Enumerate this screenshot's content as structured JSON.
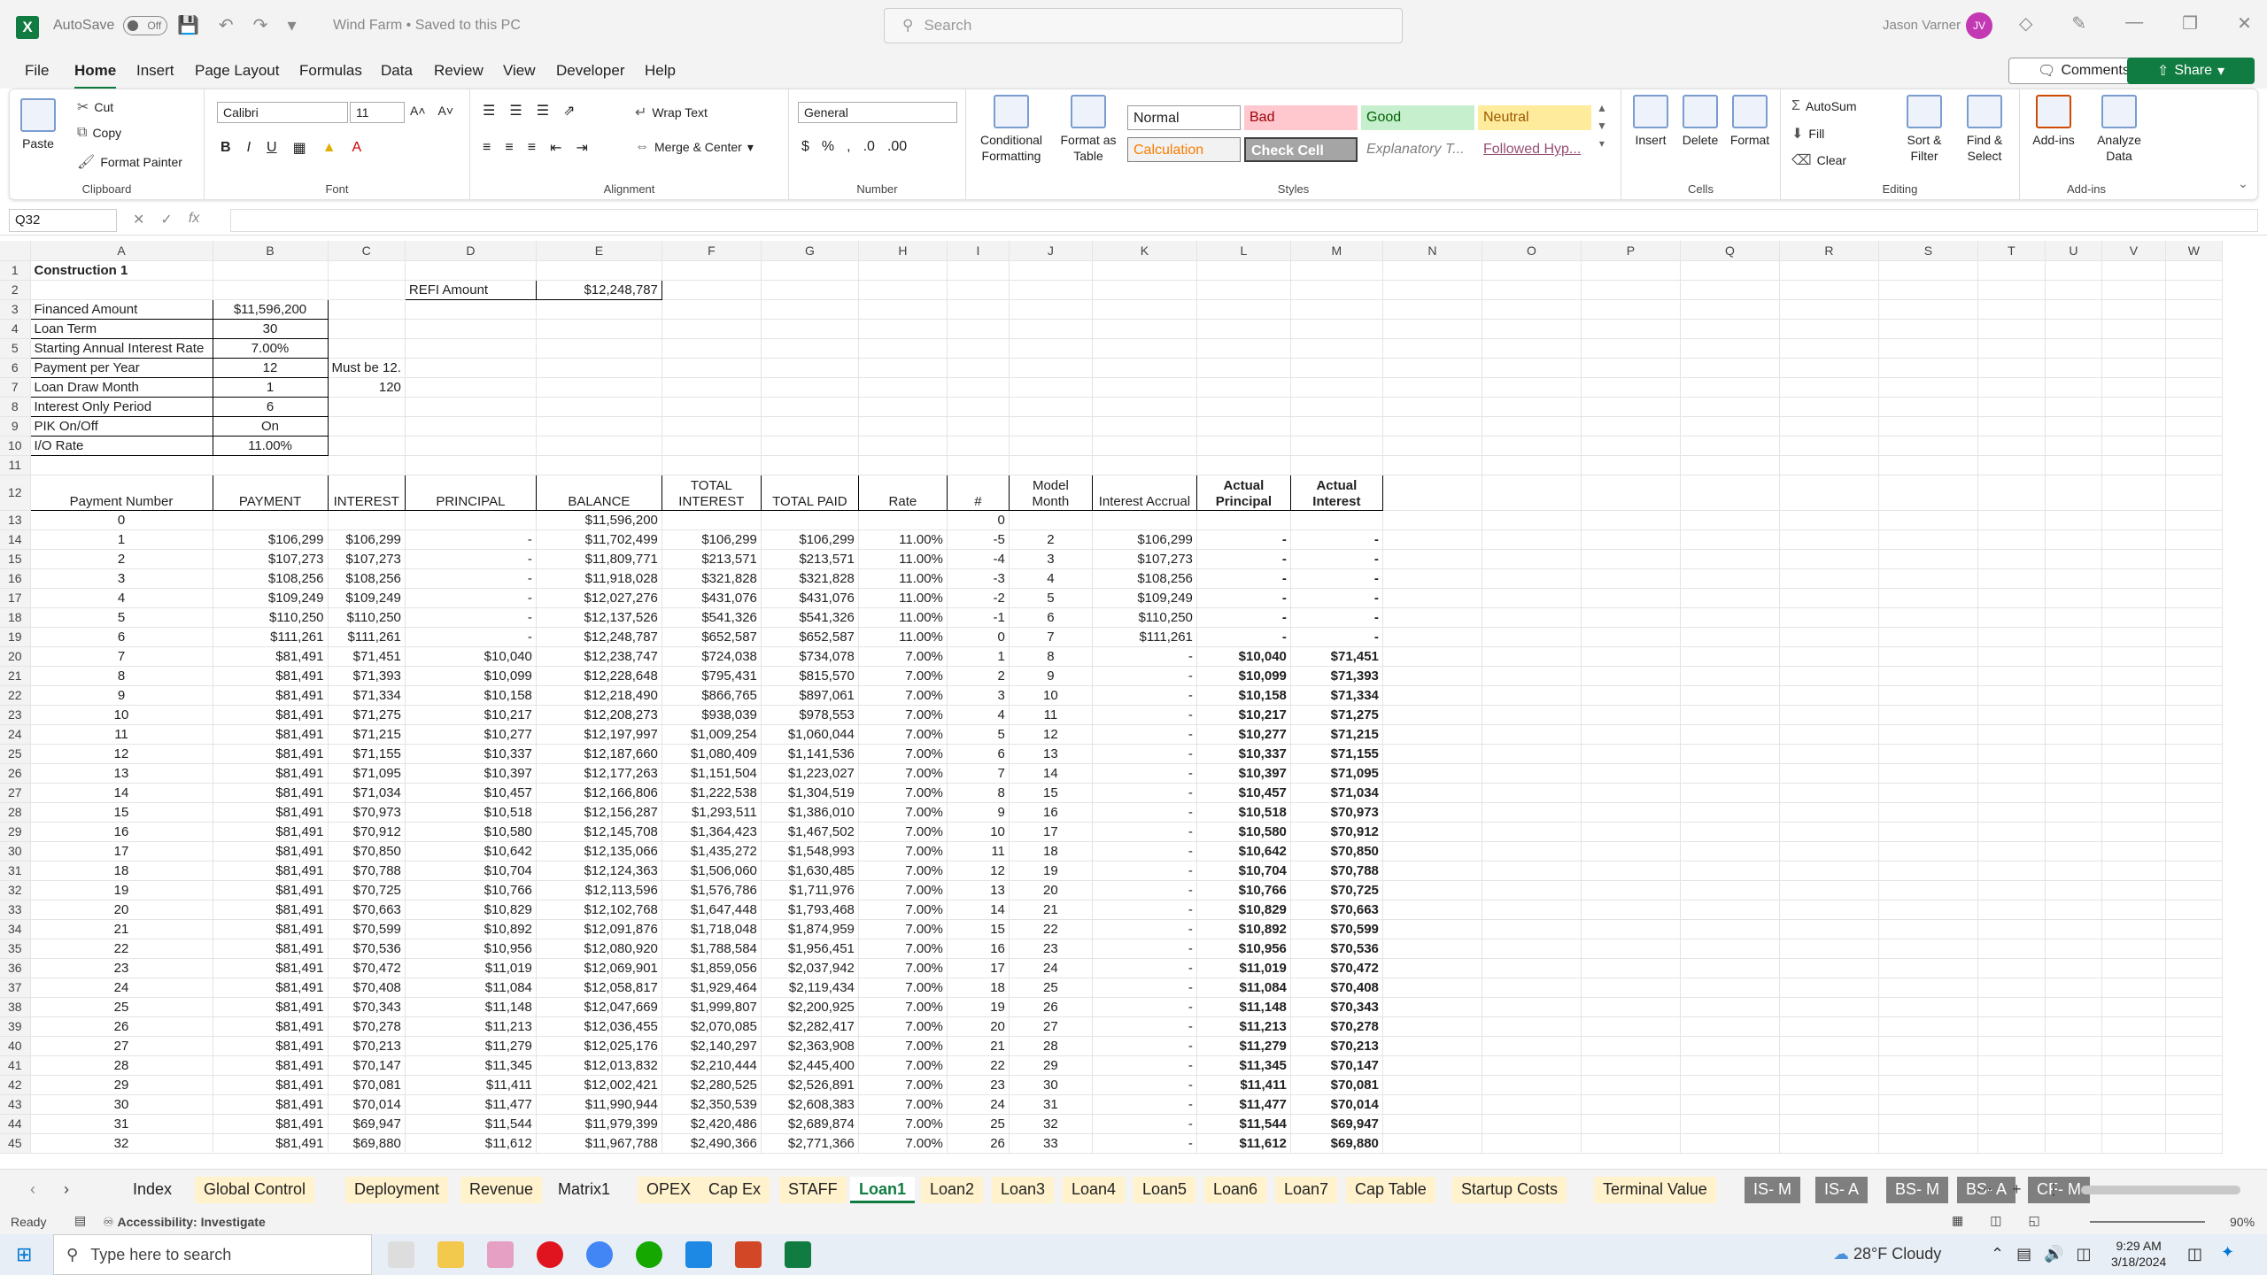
{
  "titlebar": {
    "app_logo": "X",
    "autosave_label": "AutoSave",
    "autosave_state": "Off",
    "doc_title": "Wind Farm • Saved to this PC",
    "search_placeholder": "Search",
    "user_name": "Jason Varner",
    "user_initials": "JV"
  },
  "menu": {
    "items": [
      "File",
      "Home",
      "Insert",
      "Page Layout",
      "Formulas",
      "Data",
      "Review",
      "View",
      "Developer",
      "Help"
    ],
    "active": "Home",
    "comments": "Comments",
    "share": "Share"
  },
  "ribbon": {
    "clipboard": {
      "paste": "Paste",
      "cut": "Cut",
      "copy": "Copy",
      "format_painter": "Format Painter",
      "label": "Clipboard"
    },
    "font": {
      "name": "Calibri",
      "size": "11",
      "label": "Font"
    },
    "alignment": {
      "wrap": "Wrap Text",
      "merge": "Merge & Center",
      "label": "Alignment"
    },
    "number": {
      "format": "General",
      "label": "Number"
    },
    "styles": {
      "conditional": "Conditional Formatting",
      "format_table": "Format as Table",
      "normal": "Normal",
      "bad": "Bad",
      "good": "Good",
      "neutral": "Neutral",
      "calculation": "Calculation",
      "check_cell": "Check Cell",
      "explanatory": "Explanatory T...",
      "followed": "Followed Hyp...",
      "label": "Styles"
    },
    "cells": {
      "insert": "Insert",
      "delete": "Delete",
      "format": "Format",
      "label": "Cells"
    },
    "editing": {
      "autosum": "AutoSum",
      "fill": "Fill",
      "clear": "Clear",
      "sort": "Sort & Filter",
      "find": "Find & Select",
      "label": "Editing"
    },
    "addins": {
      "addins": "Add-ins",
      "analyze": "Analyze Data",
      "label": "Add-ins"
    }
  },
  "formula_bar": {
    "name_box": "Q32",
    "fx": "fx",
    "content": ""
  },
  "columns": [
    "A",
    "B",
    "C",
    "D",
    "E",
    "F",
    "G",
    "H",
    "I",
    "J",
    "K",
    "L",
    "M",
    "N",
    "O",
    "P",
    "Q",
    "R",
    "S",
    "T",
    "U",
    "V",
    "W"
  ],
  "params": {
    "title": "Construction 1",
    "refi_label": "REFI Amount",
    "refi_value": "$12,248,787",
    "rows": [
      {
        "label": "Financed Amount",
        "value": "$11,596,200",
        "note": ""
      },
      {
        "label": "Loan Term",
        "value": "30",
        "note": ""
      },
      {
        "label": "Starting Annual Interest Rate",
        "value": "7.00%",
        "note": ""
      },
      {
        "label": "Payment per Year",
        "value": "12",
        "note": "Must be 12."
      },
      {
        "label": "Loan Draw Month",
        "value": "1",
        "note": "120"
      },
      {
        "label": "Interest Only Period",
        "value": "6",
        "note": ""
      },
      {
        "label": "PIK On/Off",
        "value": "On",
        "note": ""
      },
      {
        "label": "I/O Rate",
        "value": "11.00%",
        "note": ""
      }
    ]
  },
  "schedule": {
    "headers": [
      "Payment Number",
      "PAYMENT",
      "INTEREST",
      "PRINCIPAL",
      "BALANCE",
      "TOTAL INTEREST",
      "TOTAL PAID",
      "Rate",
      "#",
      "Model Month",
      "Interest Accrual",
      "Actual Principal",
      "Actual Interest"
    ],
    "rows": [
      [
        "0",
        "",
        "",
        "",
        "$11,596,200",
        "",
        "",
        "",
        "0",
        "",
        "",
        "",
        ""
      ],
      [
        "1",
        "$106,299",
        "$106,299",
        "-",
        "$11,702,499",
        "$106,299",
        "$106,299",
        "11.00%",
        "-5",
        "2",
        "$106,299",
        "-",
        "-"
      ],
      [
        "2",
        "$107,273",
        "$107,273",
        "-",
        "$11,809,771",
        "$213,571",
        "$213,571",
        "11.00%",
        "-4",
        "3",
        "$107,273",
        "-",
        "-"
      ],
      [
        "3",
        "$108,256",
        "$108,256",
        "-",
        "$11,918,028",
        "$321,828",
        "$321,828",
        "11.00%",
        "-3",
        "4",
        "$108,256",
        "-",
        "-"
      ],
      [
        "4",
        "$109,249",
        "$109,249",
        "-",
        "$12,027,276",
        "$431,076",
        "$431,076",
        "11.00%",
        "-2",
        "5",
        "$109,249",
        "-",
        "-"
      ],
      [
        "5",
        "$110,250",
        "$110,250",
        "-",
        "$12,137,526",
        "$541,326",
        "$541,326",
        "11.00%",
        "-1",
        "6",
        "$110,250",
        "-",
        "-"
      ],
      [
        "6",
        "$111,261",
        "$111,261",
        "-",
        "$12,248,787",
        "$652,587",
        "$652,587",
        "11.00%",
        "0",
        "7",
        "$111,261",
        "-",
        "-"
      ],
      [
        "7",
        "$81,491",
        "$71,451",
        "$10,040",
        "$12,238,747",
        "$724,038",
        "$734,078",
        "7.00%",
        "1",
        "8",
        "-",
        "$10,040",
        "$71,451"
      ],
      [
        "8",
        "$81,491",
        "$71,393",
        "$10,099",
        "$12,228,648",
        "$795,431",
        "$815,570",
        "7.00%",
        "2",
        "9",
        "-",
        "$10,099",
        "$71,393"
      ],
      [
        "9",
        "$81,491",
        "$71,334",
        "$10,158",
        "$12,218,490",
        "$866,765",
        "$897,061",
        "7.00%",
        "3",
        "10",
        "-",
        "$10,158",
        "$71,334"
      ],
      [
        "10",
        "$81,491",
        "$71,275",
        "$10,217",
        "$12,208,273",
        "$938,039",
        "$978,553",
        "7.00%",
        "4",
        "11",
        "-",
        "$10,217",
        "$71,275"
      ],
      [
        "11",
        "$81,491",
        "$71,215",
        "$10,277",
        "$12,197,997",
        "$1,009,254",
        "$1,060,044",
        "7.00%",
        "5",
        "12",
        "-",
        "$10,277",
        "$71,215"
      ],
      [
        "12",
        "$81,491",
        "$71,155",
        "$10,337",
        "$12,187,660",
        "$1,080,409",
        "$1,141,536",
        "7.00%",
        "6",
        "13",
        "-",
        "$10,337",
        "$71,155"
      ],
      [
        "13",
        "$81,491",
        "$71,095",
        "$10,397",
        "$12,177,263",
        "$1,151,504",
        "$1,223,027",
        "7.00%",
        "7",
        "14",
        "-",
        "$10,397",
        "$71,095"
      ],
      [
        "14",
        "$81,491",
        "$71,034",
        "$10,457",
        "$12,166,806",
        "$1,222,538",
        "$1,304,519",
        "7.00%",
        "8",
        "15",
        "-",
        "$10,457",
        "$71,034"
      ],
      [
        "15",
        "$81,491",
        "$70,973",
        "$10,518",
        "$12,156,287",
        "$1,293,511",
        "$1,386,010",
        "7.00%",
        "9",
        "16",
        "-",
        "$10,518",
        "$70,973"
      ],
      [
        "16",
        "$81,491",
        "$70,912",
        "$10,580",
        "$12,145,708",
        "$1,364,423",
        "$1,467,502",
        "7.00%",
        "10",
        "17",
        "-",
        "$10,580",
        "$70,912"
      ],
      [
        "17",
        "$81,491",
        "$70,850",
        "$10,642",
        "$12,135,066",
        "$1,435,272",
        "$1,548,993",
        "7.00%",
        "11",
        "18",
        "-",
        "$10,642",
        "$70,850"
      ],
      [
        "18",
        "$81,491",
        "$70,788",
        "$10,704",
        "$12,124,363",
        "$1,506,060",
        "$1,630,485",
        "7.00%",
        "12",
        "19",
        "-",
        "$10,704",
        "$70,788"
      ],
      [
        "19",
        "$81,491",
        "$70,725",
        "$10,766",
        "$12,113,596",
        "$1,576,786",
        "$1,711,976",
        "7.00%",
        "13",
        "20",
        "-",
        "$10,766",
        "$70,725"
      ],
      [
        "20",
        "$81,491",
        "$70,663",
        "$10,829",
        "$12,102,768",
        "$1,647,448",
        "$1,793,468",
        "7.00%",
        "14",
        "21",
        "-",
        "$10,829",
        "$70,663"
      ],
      [
        "21",
        "$81,491",
        "$70,599",
        "$10,892",
        "$12,091,876",
        "$1,718,048",
        "$1,874,959",
        "7.00%",
        "15",
        "22",
        "-",
        "$10,892",
        "$70,599"
      ],
      [
        "22",
        "$81,491",
        "$70,536",
        "$10,956",
        "$12,080,920",
        "$1,788,584",
        "$1,956,451",
        "7.00%",
        "16",
        "23",
        "-",
        "$10,956",
        "$70,536"
      ],
      [
        "23",
        "$81,491",
        "$70,472",
        "$11,019",
        "$12,069,901",
        "$1,859,056",
        "$2,037,942",
        "7.00%",
        "17",
        "24",
        "-",
        "$11,019",
        "$70,472"
      ],
      [
        "24",
        "$81,491",
        "$70,408",
        "$11,084",
        "$12,058,817",
        "$1,929,464",
        "$2,119,434",
        "7.00%",
        "18",
        "25",
        "-",
        "$11,084",
        "$70,408"
      ],
      [
        "25",
        "$81,491",
        "$70,343",
        "$11,148",
        "$12,047,669",
        "$1,999,807",
        "$2,200,925",
        "7.00%",
        "19",
        "26",
        "-",
        "$11,148",
        "$70,343"
      ],
      [
        "26",
        "$81,491",
        "$70,278",
        "$11,213",
        "$12,036,455",
        "$2,070,085",
        "$2,282,417",
        "7.00%",
        "20",
        "27",
        "-",
        "$11,213",
        "$70,278"
      ],
      [
        "27",
        "$81,491",
        "$70,213",
        "$11,279",
        "$12,025,176",
        "$2,140,297",
        "$2,363,908",
        "7.00%",
        "21",
        "28",
        "-",
        "$11,279",
        "$70,213"
      ],
      [
        "28",
        "$81,491",
        "$70,147",
        "$11,345",
        "$12,013,832",
        "$2,210,444",
        "$2,445,400",
        "7.00%",
        "22",
        "29",
        "-",
        "$11,345",
        "$70,147"
      ],
      [
        "29",
        "$81,491",
        "$70,081",
        "$11,411",
        "$12,002,421",
        "$2,280,525",
        "$2,526,891",
        "7.00%",
        "23",
        "30",
        "-",
        "$11,411",
        "$70,081"
      ],
      [
        "30",
        "$81,491",
        "$70,014",
        "$11,477",
        "$11,990,944",
        "$2,350,539",
        "$2,608,383",
        "7.00%",
        "24",
        "31",
        "-",
        "$11,477",
        "$70,014"
      ],
      [
        "31",
        "$81,491",
        "$69,947",
        "$11,544",
        "$11,979,399",
        "$2,420,486",
        "$2,689,874",
        "7.00%",
        "25",
        "32",
        "-",
        "$11,544",
        "$69,947"
      ],
      [
        "32",
        "$81,491",
        "$69,880",
        "$11,612",
        "$11,967,788",
        "$2,490,366",
        "$2,771,366",
        "7.00%",
        "26",
        "33",
        "-",
        "$11,612",
        "$69,880"
      ]
    ]
  },
  "sheet_tabs": [
    {
      "name": "Index",
      "style": "plain"
    },
    {
      "name": "Global Control",
      "style": "yellow"
    },
    {
      "name": "Deployment",
      "style": "yellow"
    },
    {
      "name": "Revenue",
      "style": "yellow"
    },
    {
      "name": "Matrix1",
      "style": "plain"
    },
    {
      "name": "OPEX",
      "style": "yellow"
    },
    {
      "name": "Cap Ex",
      "style": "yellow"
    },
    {
      "name": "STAFF",
      "style": "yellow"
    },
    {
      "name": "Loan1",
      "style": "active"
    },
    {
      "name": "Loan2",
      "style": "yellow"
    },
    {
      "name": "Loan3",
      "style": "yellow"
    },
    {
      "name": "Loan4",
      "style": "yellow"
    },
    {
      "name": "Loan5",
      "style": "yellow"
    },
    {
      "name": "Loan6",
      "style": "yellow"
    },
    {
      "name": "Loan7",
      "style": "yellow"
    },
    {
      "name": "Cap Table",
      "style": "yellow"
    },
    {
      "name": "Startup Costs",
      "style": "yellow"
    },
    {
      "name": "Terminal Value",
      "style": "yellow"
    },
    {
      "name": "IS- M",
      "style": "gray"
    },
    {
      "name": "IS- A",
      "style": "gray"
    },
    {
      "name": "BS- M",
      "style": "gray"
    },
    {
      "name": "BS- A",
      "style": "gray"
    },
    {
      "name": "CF- M",
      "style": "gray"
    }
  ],
  "status": {
    "ready": "Ready",
    "accessibility": "Accessibility: Investigate",
    "zoom": "90%"
  },
  "taskbar": {
    "search": "Type here to search",
    "weather": "28°F  Cloudy",
    "time": "9:29 AM",
    "date": "3/18/2024"
  },
  "colors": {
    "excel_green": "#107c41",
    "tab_yellow": "#fff2cc",
    "tab_gray": "#7f7f7f"
  }
}
